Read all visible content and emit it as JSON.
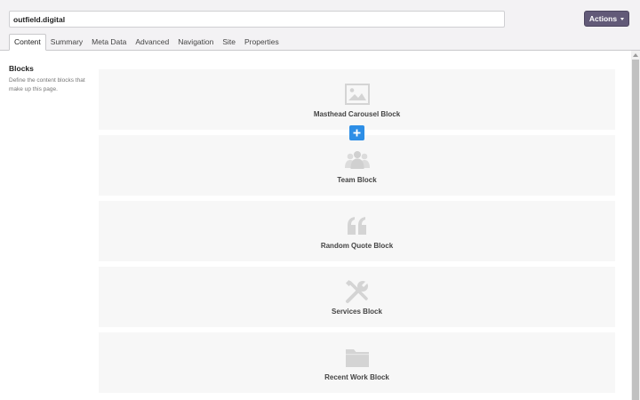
{
  "header": {
    "title_value": "outfield.digital",
    "actions_label": "Actions"
  },
  "tabs": [
    {
      "label": "Content",
      "active": true
    },
    {
      "label": "Summary"
    },
    {
      "label": "Meta Data"
    },
    {
      "label": "Advanced"
    },
    {
      "label": "Navigation"
    },
    {
      "label": "Site"
    },
    {
      "label": "Properties"
    }
  ],
  "section": {
    "title": "Blocks",
    "description": "Define the content blocks that make up this page."
  },
  "blocks": [
    {
      "label": "Masthead Carousel Block",
      "icon": "image-icon"
    },
    {
      "label": "Team Block",
      "icon": "users-icon"
    },
    {
      "label": "Random Quote Block",
      "icon": "quote-icon"
    },
    {
      "label": "Services Block",
      "icon": "tools-icon"
    },
    {
      "label": "Recent Work Block",
      "icon": "folder-icon"
    }
  ],
  "colors": {
    "accent": "#2d8ee6",
    "actions_button": "#625a78",
    "block_background": "#f7f7f7",
    "icon_gray": "#d4d4d4"
  }
}
